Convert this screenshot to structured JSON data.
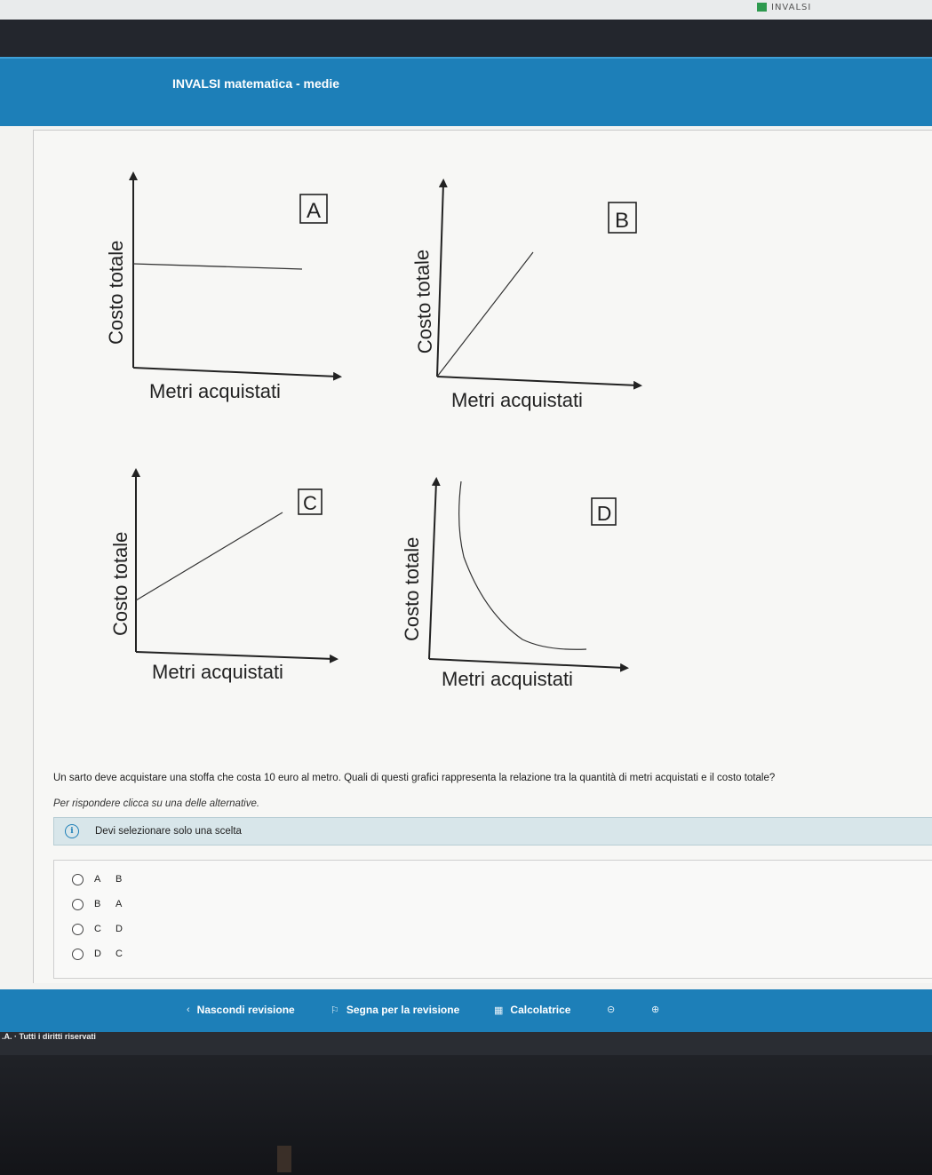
{
  "window": {
    "tab_label": "INVALSI",
    "logo_color": "#2e9a4f"
  },
  "header": {
    "title": "INVALSI matematica - medie",
    "color": "#1d7fb8"
  },
  "graphs": [
    {
      "label": "A",
      "ylabel": "Costo totale",
      "xlabel": "Metri acquistati",
      "shape": "horizontal-line"
    },
    {
      "label": "B",
      "ylabel": "Costo totale",
      "xlabel": "Metri acquistati",
      "shape": "line-through-origin"
    },
    {
      "label": "C",
      "ylabel": "Costo totale",
      "xlabel": "Metri acquistati",
      "shape": "line-with-positive-intercept"
    },
    {
      "label": "D",
      "ylabel": "Costo totale",
      "xlabel": "Metri acquistati",
      "shape": "decreasing-curve"
    }
  ],
  "question": {
    "text": "Un sarto deve acquistare una stoffa che costa 10 euro al metro. Quali di questi grafici rappresenta la relazione tra la quantità di metri acquistati e il costo totale?",
    "instruction": "Per rispondere clicca su una delle alternative.",
    "info": "Devi selezionare solo una scelta",
    "info_icon": "info-icon"
  },
  "options": [
    {
      "key": "A",
      "label": "B",
      "selected": false
    },
    {
      "key": "B",
      "label": "A",
      "selected": false
    },
    {
      "key": "C",
      "label": "D",
      "selected": false
    },
    {
      "key": "D",
      "label": "C",
      "selected": false
    }
  ],
  "footer": {
    "hide_review": "Nascondi revisione",
    "hide_review_icon": "chevron-left-icon",
    "mark_review": "Segna per la revisione",
    "mark_review_icon": "flag-icon",
    "calculator": "Calcolatrice",
    "calculator_icon": "calculator-icon",
    "zoom_out_icon": "zoom-out-icon",
    "zoom_in_icon": "zoom-in-icon"
  },
  "copyright": ".A. · Tutti i diritti riservati"
}
